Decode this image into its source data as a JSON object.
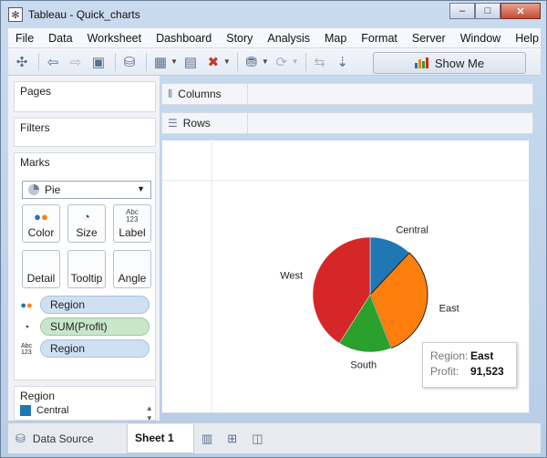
{
  "window": {
    "title": "Tableau - Quick_charts",
    "min": "–",
    "max": "□",
    "close": "✕"
  },
  "menu": [
    "File",
    "Data",
    "Worksheet",
    "Dashboard",
    "Story",
    "Analysis",
    "Map",
    "Format",
    "Server",
    "Window",
    "Help"
  ],
  "toolbar": {
    "show_me_label": "Show Me"
  },
  "left": {
    "pages_title": "Pages",
    "filters_title": "Filters",
    "marks_title": "Marks",
    "mark_type": "Pie",
    "buttons": {
      "color": "Color",
      "size": "Size",
      "label": "Label",
      "detail": "Detail",
      "tooltip": "Tooltip",
      "angle": "Angle"
    },
    "pills": [
      {
        "text": "Region",
        "kind": "color"
      },
      {
        "text": "SUM(Profit)",
        "kind": "angle"
      },
      {
        "text": "Region",
        "kind": "label"
      }
    ],
    "legend_title": "Region",
    "legend_first_item": "Central",
    "legend_first_color": "#1f77b4"
  },
  "shelves": {
    "columns": "Columns",
    "rows": "Rows"
  },
  "chart_data": {
    "type": "pie",
    "categories": [
      "Central",
      "East",
      "South",
      "West"
    ],
    "colors": [
      "#1f77b4",
      "#ff7f0e",
      "#2ca02c",
      "#d62728"
    ],
    "shares": [
      0.12,
      0.32,
      0.15,
      0.41
    ]
  },
  "tooltip": {
    "region_label": "Region:",
    "region_value": "East",
    "profit_label": "Profit:",
    "profit_value": "91,523"
  },
  "tabs": {
    "data_source": "Data Source",
    "sheet": "Sheet 1"
  }
}
